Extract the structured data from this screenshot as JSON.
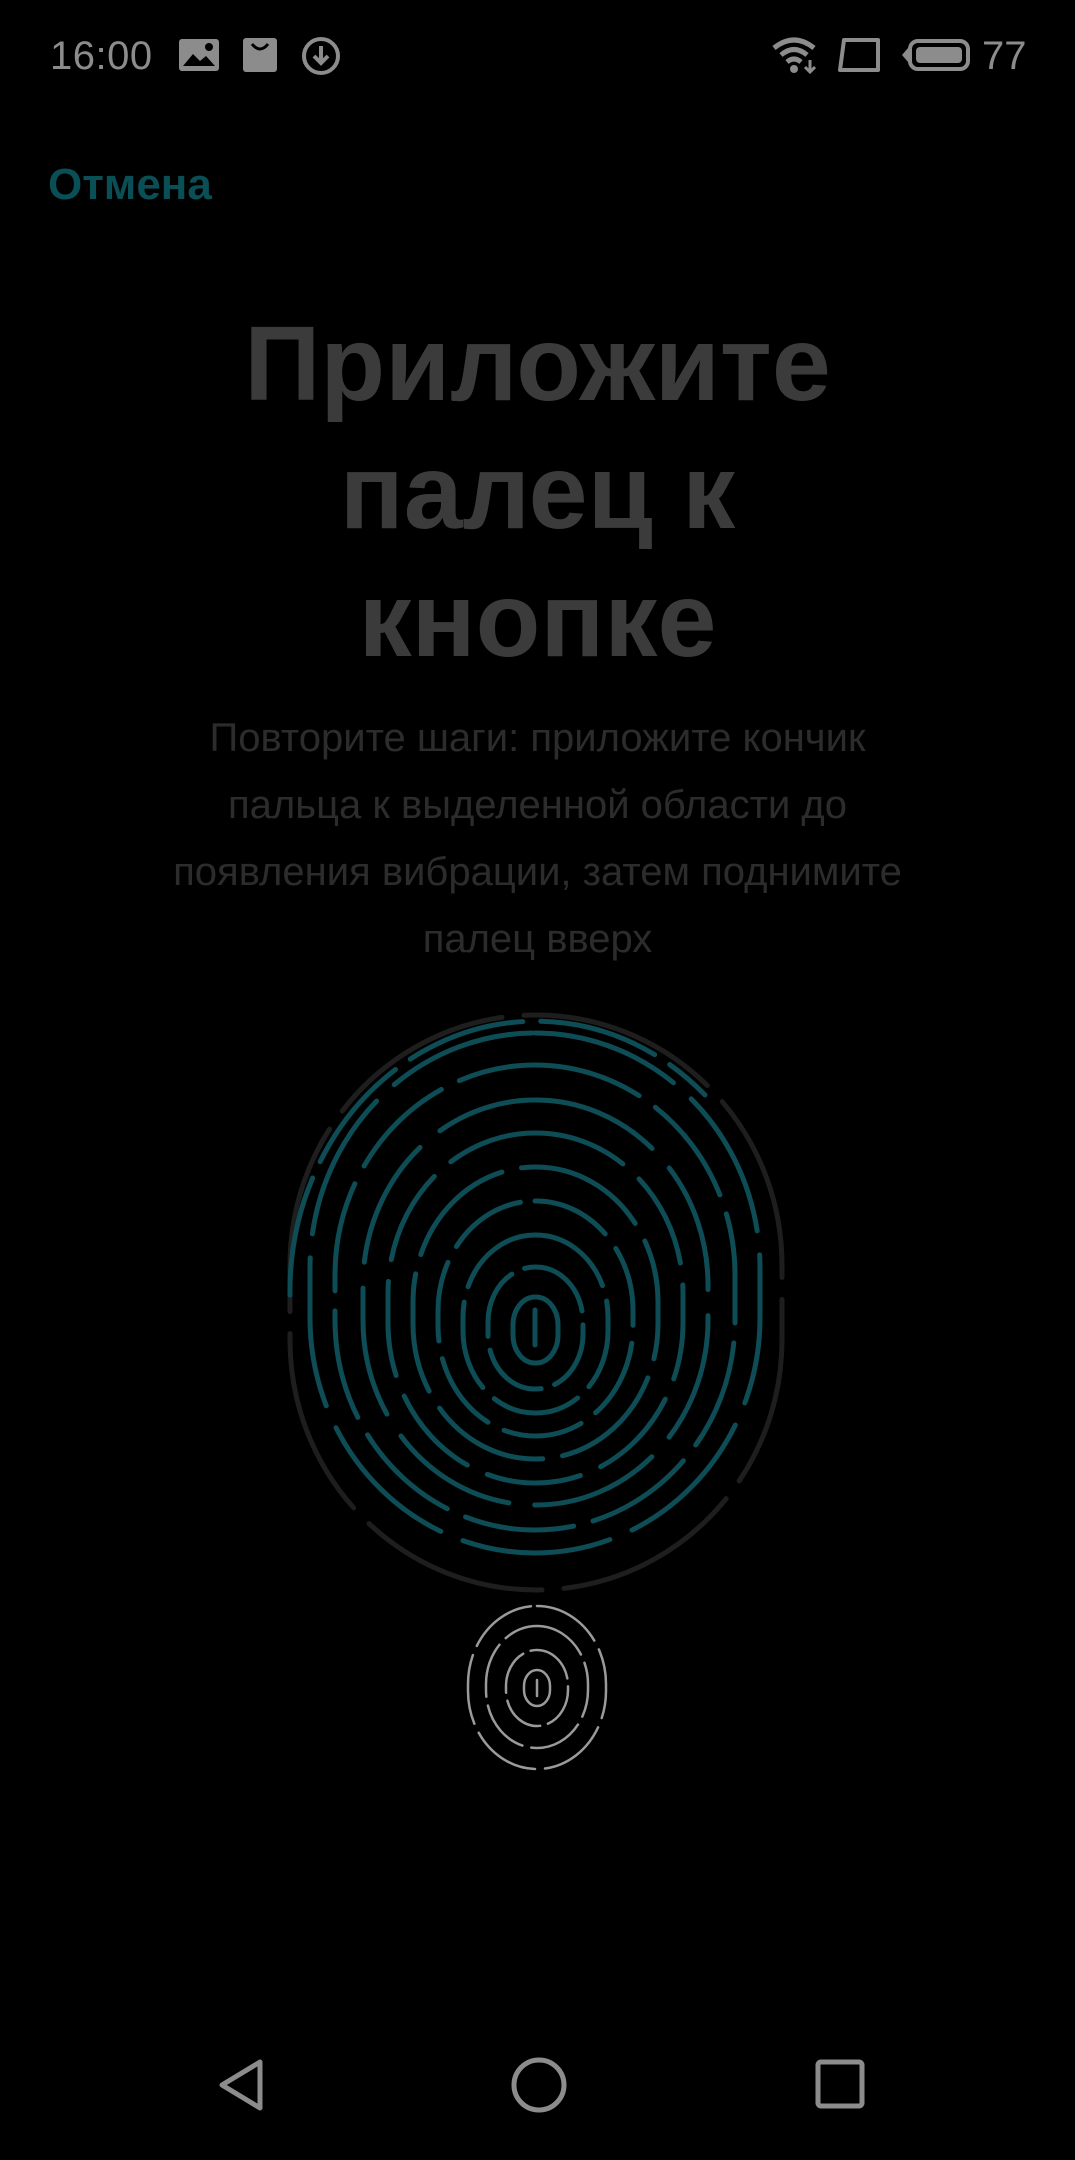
{
  "status_bar": {
    "time": "16:00",
    "icons": [
      "image-notification-icon",
      "bag-notification-icon",
      "download-icon"
    ],
    "right_icons": [
      "wifi-icon",
      "screen-icon",
      "battery-icon"
    ],
    "battery_level": "77"
  },
  "header": {
    "cancel_label": "Отмена"
  },
  "main": {
    "title_lines": [
      "Приложите",
      "палец к",
      "кнопке"
    ],
    "description_lines": [
      "Повторите шаги: приложите кончик",
      "пальца к выделенной области до",
      "появления вибрации, затем поднимите",
      "палец вверх"
    ]
  },
  "colors": {
    "background": "#000000",
    "accent": "#0a4f56",
    "fingerprint_active": "#0e4d55",
    "fingerprint_inactive": "#1e1e1e",
    "sensor_stroke": "#9a9a9a"
  },
  "icons": {
    "enroll_graphic": "fingerprint-progress-icon",
    "sensor": "fingerprint-sensor-icon"
  },
  "navigation": {
    "buttons": [
      "back-icon",
      "home-icon",
      "recents-icon"
    ]
  }
}
